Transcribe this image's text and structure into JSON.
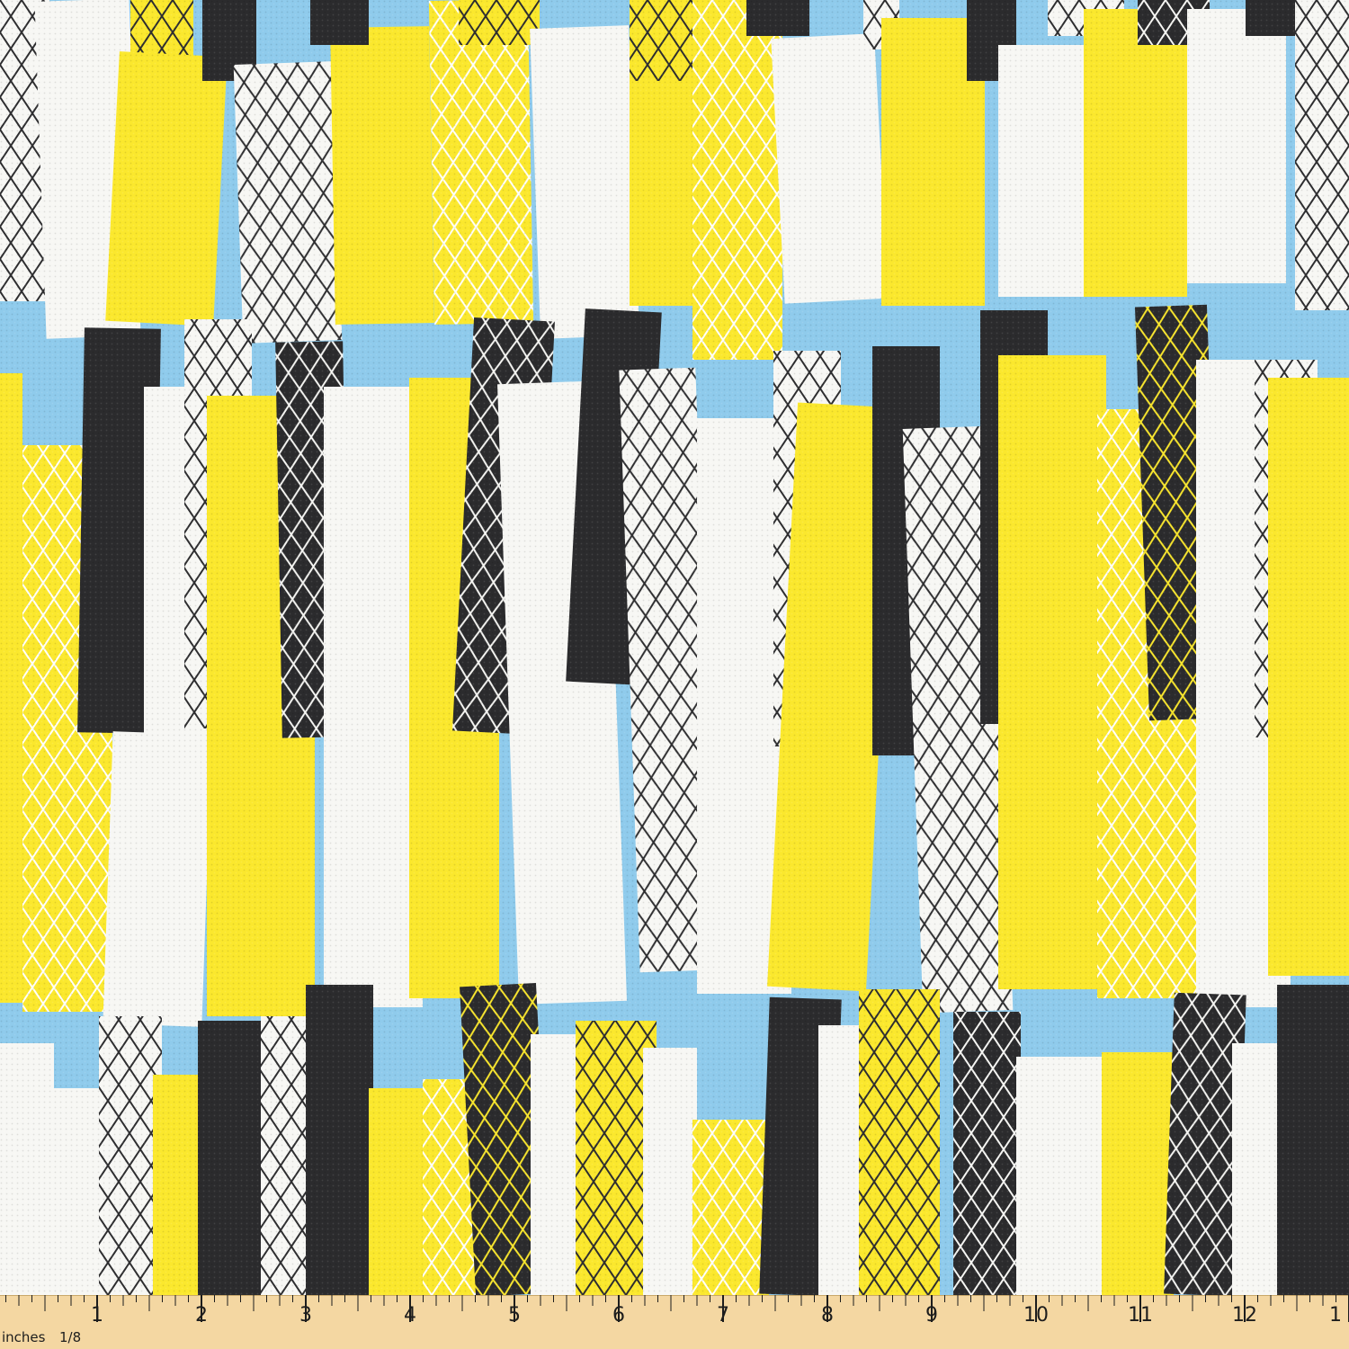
{
  "colors": {
    "sky": "#8fcbec",
    "yellow": "#fbe82d",
    "white": "#f7f7f4",
    "dark": "#2b2b2d",
    "mesh_dark": "#2d2d2f",
    "mesh_light": "#ffffff",
    "ruler": "#f4d7a2",
    "ruler_ink": "#1d1d1d"
  },
  "pattern": {
    "name": "geometric-vertical-stripes",
    "tile_types": [
      "solid-white",
      "solid-yellow",
      "solid-dark",
      "mesh-dark-on-white",
      "mesh-white-on-yellow",
      "mesh-dark-on-yellow",
      "mesh-white-on-dark"
    ]
  },
  "ruler": {
    "unit_label": "inches",
    "fraction_label": "1/8",
    "numbers": [
      "1",
      "2",
      "3",
      "4",
      "5",
      "6",
      "7",
      "8",
      "9",
      "10",
      "11",
      "12",
      "1"
    ]
  }
}
